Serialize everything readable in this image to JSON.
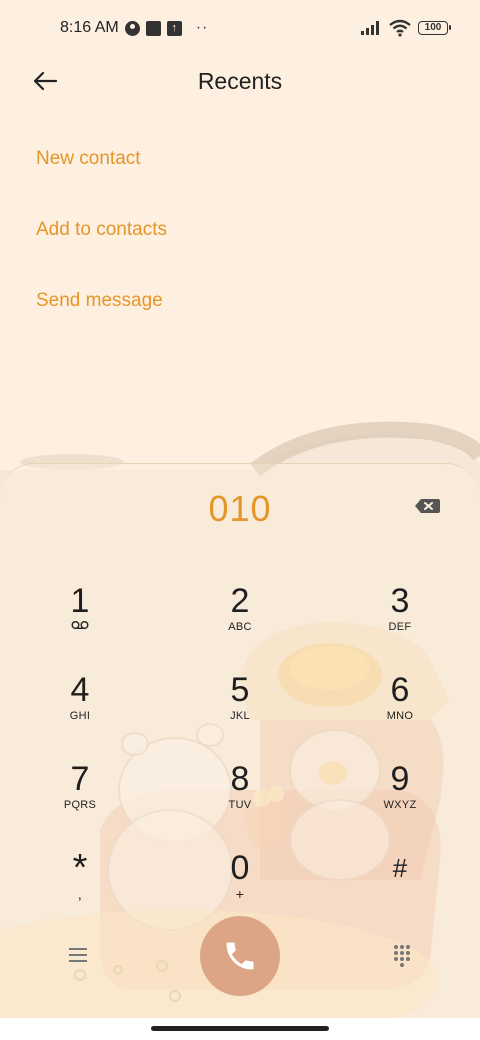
{
  "status_bar": {
    "time": "8:16 AM",
    "dots": "··",
    "battery": "100",
    "icons": [
      "app-round-icon",
      "square-icon",
      "upload-icon",
      "signal-icon",
      "wifi-icon",
      "battery-icon"
    ]
  },
  "header": {
    "title": "Recents",
    "back_icon": "arrow-left-icon"
  },
  "menu": {
    "new_contact": "New contact",
    "add_to_contacts": "Add to contacts",
    "send_message": "Send message"
  },
  "dialer": {
    "number": "010",
    "keys": [
      {
        "digit": "1",
        "letters": ""
      },
      {
        "digit": "2",
        "letters": "ABC"
      },
      {
        "digit": "3",
        "letters": "DEF"
      },
      {
        "digit": "4",
        "letters": "GHI"
      },
      {
        "digit": "5",
        "letters": "JKL"
      },
      {
        "digit": "6",
        "letters": "MNO"
      },
      {
        "digit": "7",
        "letters": "PQRS"
      },
      {
        "digit": "8",
        "letters": "TUV"
      },
      {
        "digit": "9",
        "letters": "WXYZ"
      },
      {
        "digit": "*",
        "letters": ","
      },
      {
        "digit": "0",
        "letters": "+"
      },
      {
        "digit": "#",
        "letters": ""
      }
    ]
  },
  "colors": {
    "accent": "#e6952a",
    "background": "#fdf0e0",
    "call_button": "#dba586"
  }
}
